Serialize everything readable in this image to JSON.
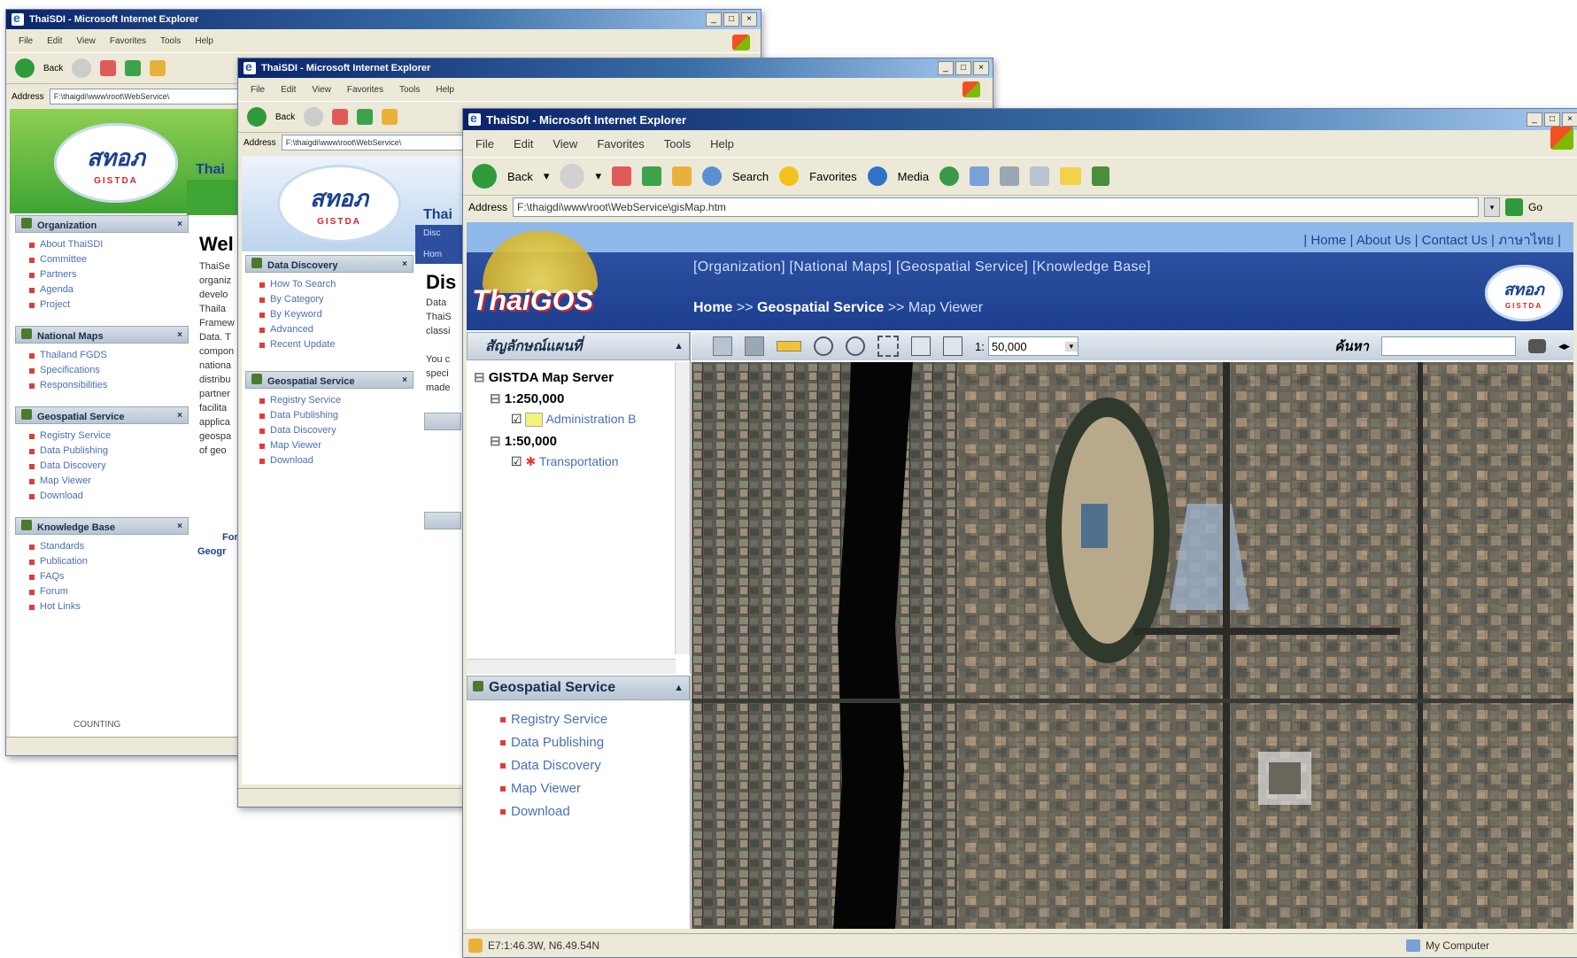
{
  "window1": {
    "title": "ThaiSDI - Microsoft Internet Explorer",
    "menu": [
      "File",
      "Edit",
      "View",
      "Favorites",
      "Tools",
      "Help"
    ],
    "back_label": "Back",
    "address_label": "Address",
    "address_value": "F:\\thaigdi\\www\\root\\WebService\\",
    "logo_thai": "สทอภ",
    "logo_en": "GISTDA",
    "brand": "Thai",
    "welcome": "Wel",
    "sections": [
      {
        "title": "Organization",
        "items": [
          "About ThaiSDI",
          "Committee",
          "Partners",
          "Agenda",
          "Project"
        ]
      },
      {
        "title": "National Maps",
        "items": [
          "Thailand FGDS",
          "Specifications",
          "Responsibilities"
        ]
      },
      {
        "title": "Geospatial Service",
        "items": [
          "Registry Service",
          "Data Publishing",
          "Data Discovery",
          "Map Viewer",
          "Download"
        ]
      },
      {
        "title": "Knowledge Base",
        "items": [
          "Standards",
          "Publication",
          "FAQs",
          "Forum",
          "Hot Links"
        ]
      }
    ],
    "counting": "COUNTING",
    "body_text": [
      "ThaiSe",
      "organiz",
      "develo",
      "Thaila",
      "Framew",
      "Data. T",
      "compon",
      "nationa",
      "distribu",
      "partner",
      "facilita",
      "applica",
      "geospa",
      "of geo"
    ],
    "footer_link_1": "For",
    "footer_link_2": "Geogr"
  },
  "window2": {
    "title": "ThaiSDI - Microsoft Internet Explorer",
    "menu": [
      "File",
      "Edit",
      "View",
      "Favorites",
      "Tools",
      "Help"
    ],
    "back_label": "Back",
    "address_label": "Address",
    "address_value": "F:\\thaigdi\\www\\root\\WebService\\",
    "logo_thai": "สทอภ",
    "logo_en": "GISTDA",
    "brand": "Thai",
    "heading": "Dis",
    "nav_a": "Disc",
    "nav_b": "Hom",
    "sections": [
      {
        "title": "Data Discovery",
        "items": [
          "How To Search",
          "By Category",
          "By Keyword",
          "Advanced",
          "Recent Update"
        ]
      },
      {
        "title": "Geospatial Service",
        "items": [
          "Registry Service",
          "Data Publishing",
          "Data Discovery",
          "Map Viewer",
          "Download"
        ]
      }
    ],
    "body_text": [
      "Data",
      "ThaiS",
      "classi"
    ],
    "body_text2": [
      "You c",
      "speci",
      "made"
    ]
  },
  "window3": {
    "title": "ThaiSDI - Microsoft Internet Explorer",
    "menu": [
      "File",
      "Edit",
      "View",
      "Favorites",
      "Tools",
      "Help"
    ],
    "toolbar": {
      "back": "Back",
      "search": "Search",
      "favorites": "Favorites",
      "media": "Media"
    },
    "address_label": "Address",
    "address_value": "F:\\thaigdi\\www\\root\\WebService\\gisMap.htm",
    "go_label": "Go",
    "top_links": "| Home | About Us | Contact Us | ภาษาไทย |",
    "nav_links": "[Organization] [National Maps] [Geospatial Service] [Knowledge Base]",
    "breadcrumb": {
      "home": "Home",
      "sep1": ">>",
      "service": "Geospatial Service",
      "sep2": ">>",
      "current": "Map Viewer"
    },
    "brand_logo": "ThaiGOS",
    "logo_thai": "สทอภ",
    "logo_en": "GISTDA",
    "layers_panel_title": "สัญลักษณ์แผนที่",
    "tree": {
      "root": "GISTDA Map Server",
      "group1": "1:250,000",
      "layer1": "Administration B",
      "group2": "1:50,000",
      "layer2": "Transportation"
    },
    "scale_prefix": "1:",
    "scale_value": "50,000",
    "search_label": "ค้นหา",
    "service_panel": {
      "title": "Geospatial Service",
      "items": [
        "Registry Service",
        "Data Publishing",
        "Data Discovery",
        "Map Viewer",
        "Download"
      ]
    },
    "status_left": "E7:1:46.3W, N6.49.54N",
    "status_right": "My Computer"
  },
  "colors": {
    "title_gradient_start": "#0a246a",
    "header_blue": "#1e3f8f",
    "link_blue": "#4a6fb5",
    "bullet_red": "#e23b3b",
    "green_banner": "#3fa535"
  },
  "icons": [
    "back-icon",
    "forward-icon",
    "stop-icon",
    "refresh-icon",
    "home-icon",
    "search-icon",
    "favorites-icon",
    "media-icon",
    "history-icon",
    "mail-icon",
    "print-icon",
    "edit-icon",
    "folder-icon",
    "messenger-icon",
    "windows-logo-icon",
    "zoom-in-icon",
    "zoom-out-icon",
    "pan-icon",
    "full-extent-icon",
    "measure-icon",
    "identify-icon",
    "binoculars-icon"
  ]
}
